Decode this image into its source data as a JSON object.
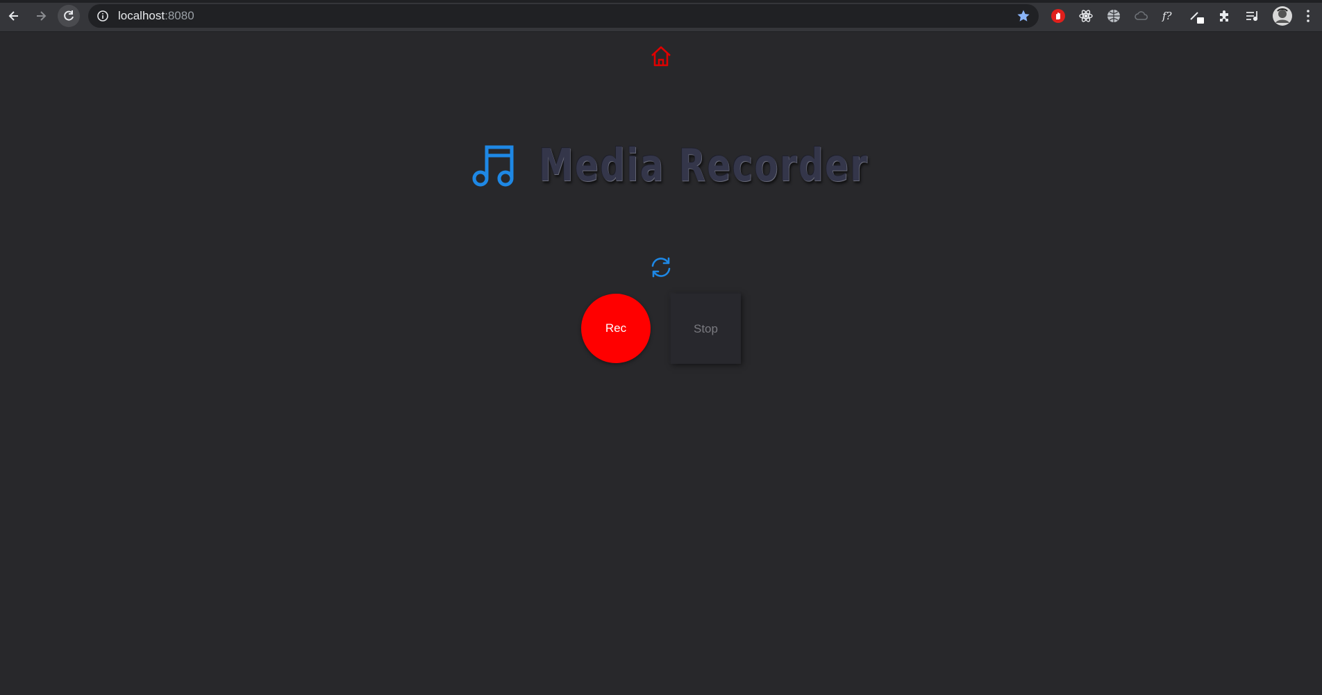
{
  "browser": {
    "url_host": "localhost",
    "url_port": ":8080",
    "nav": {
      "back_icon": "arrow-left-icon",
      "forward_icon": "arrow-right-icon",
      "reload_icon": "reload-icon"
    },
    "extensions": [
      "adblock-icon",
      "react-devtools-icon",
      "globe-icon",
      "cloud-icon",
      "formula-icon",
      "pen-icon",
      "puzzle-icon",
      "reading-list-icon",
      "profile-avatar",
      "menu-kebab-icon"
    ],
    "accent": "#8ab4f8"
  },
  "page": {
    "title": "Media Recorder",
    "rec_label": "Rec",
    "stop_label": "Stop",
    "colors": {
      "background": "#28282b",
      "rec": "#ff0000",
      "home_icon": "#e00000",
      "accent_blue": "#1e88e5"
    }
  }
}
